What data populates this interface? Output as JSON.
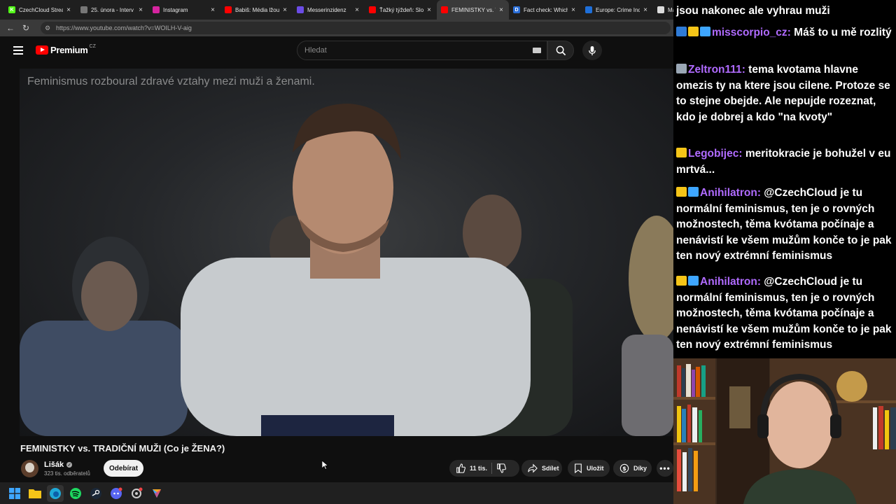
{
  "browser": {
    "tabs": [
      {
        "label": "CzechCloud Stream",
        "color": "#53fc18",
        "icon": "K"
      },
      {
        "label": "25. února - Interv",
        "color": "#777777",
        "icon": ""
      },
      {
        "label": "Instagram",
        "color": "#d6249f",
        "icon": ""
      },
      {
        "label": "Babiš: Média lžou",
        "color": "#ff0000",
        "icon": ""
      },
      {
        "label": "Messerinzidenz",
        "color": "#6b4ce6",
        "icon": ""
      },
      {
        "label": "Ťažký týždeň: Slov",
        "color": "#ff0000",
        "icon": ""
      },
      {
        "label": "FEMINISTKY vs. TR",
        "color": "#ff0000",
        "icon": "",
        "active": true
      },
      {
        "label": "Fact check: Which",
        "color": "#2a6ed8",
        "icon": "D"
      },
      {
        "label": "Europe: Crime Ind",
        "color": "#1e6fd9",
        "icon": ""
      },
      {
        "label": "Ma",
        "color": "#dddddd",
        "icon": ""
      }
    ],
    "url": "https://www.youtube.com/watch?v=WOILH-V-aig"
  },
  "youtube": {
    "brand": "Premium",
    "region": "CZ",
    "search_placeholder": "Hledat",
    "video_caption": "Feminismus rozboural zdravé vztahy mezi muži a ženami.",
    "title": "FEMINISTKY vs. TRADIČNÍ MUŽI (Co je ŽENA?)",
    "channel": "Lišák",
    "subscribers": "323 tis. odběratelů",
    "subscribe_label": "Odebírat",
    "likes": "11 tis.",
    "share_label": "Sdílet",
    "save_label": "Uložit",
    "thanks_label": "Díky"
  },
  "chat": {
    "top_line": "jsou nakonec ale vyhrau muži",
    "messages": [
      {
        "user": "misscorpio_cz",
        "text": "Máš to u mě rozlitý",
        "badges": [
          "#2f7bd6",
          "#f5c518",
          "#3ea6ff"
        ]
      },
      {
        "user": "Zeltron111",
        "text": "tema kvotama hlavne omezis ty na ktere jsou cilene. Protoze se to stejne obejde. Ale nepujde rozeznat, kdo je dobrej a kdo \"na kvoty\"",
        "badges": [
          "#9aa7b5"
        ]
      },
      {
        "user": "Legobijec",
        "text": "meritokracie je bohužel v eu mrtvá...",
        "badges": [
          "#f5c518"
        ]
      },
      {
        "user": "Anihilatron",
        "text": "@CzechCloud je tu normální feminismus, ten je o rovných možnostech, těma kvótama počínaje a nenávistí ke všem mužům konče to je pak ten nový extrémní feminismus",
        "badges": [
          "#f5c518",
          "#3ea6ff"
        ]
      },
      {
        "user": "Anihilatron",
        "text": "@CzechCloud je tu normální feminismus, ten je o rovných možnostech, těma kvótama počínaje a nenávistí ke všem mužům konče to je pak ten nový extrémní feminismus",
        "badges": [
          "#f5c518",
          "#3ea6ff"
        ]
      }
    ]
  },
  "colors": {
    "username": "#b06bff",
    "youtube_red": "#ff0000",
    "background": "#0f0f0f"
  }
}
